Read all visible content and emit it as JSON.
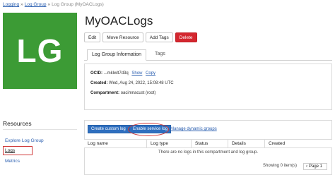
{
  "breadcrumb": {
    "items": [
      "Logging",
      "Log Group",
      "Log Group (MyOACLogs)"
    ],
    "separator": "»"
  },
  "logo": {
    "text": "LG",
    "color": "#3c9b35"
  },
  "header": {
    "title": "MyOACLogs"
  },
  "actions": {
    "edit": "Edit",
    "move": "Move Resource",
    "add_tags": "Add Tags",
    "delete": "Delete"
  },
  "tabs": {
    "info": "Log Group Information",
    "tags": "Tags"
  },
  "info": {
    "ocid_label": "OCID:",
    "ocid_value": "...mklwlt7d3q",
    "show": "Show",
    "copy": "Copy",
    "created_label": "Created:",
    "created_value": "Wed, Aug 24, 2022, 15:08:48 UTC",
    "compartment_label": "Compartment:",
    "compartment_value": "oacimnacust (root)"
  },
  "resources": {
    "title": "Resources",
    "items": [
      "Explore Log Group",
      "Logs",
      "Metrics"
    ]
  },
  "logs": {
    "create_button": "Create custom log",
    "enable_button": "Enable service log",
    "manage_link": "Manage dynamic groups",
    "columns": [
      "Log name",
      "Log type",
      "Status",
      "Details",
      "Created"
    ],
    "empty_message": "There are no logs in this compartment and log group.",
    "showing": "Showing 0 item(s)",
    "page": "Page 1"
  },
  "colors": {
    "accent": "#2f6fbf",
    "danger": "#d4272f",
    "highlight": "#d13a3a"
  }
}
